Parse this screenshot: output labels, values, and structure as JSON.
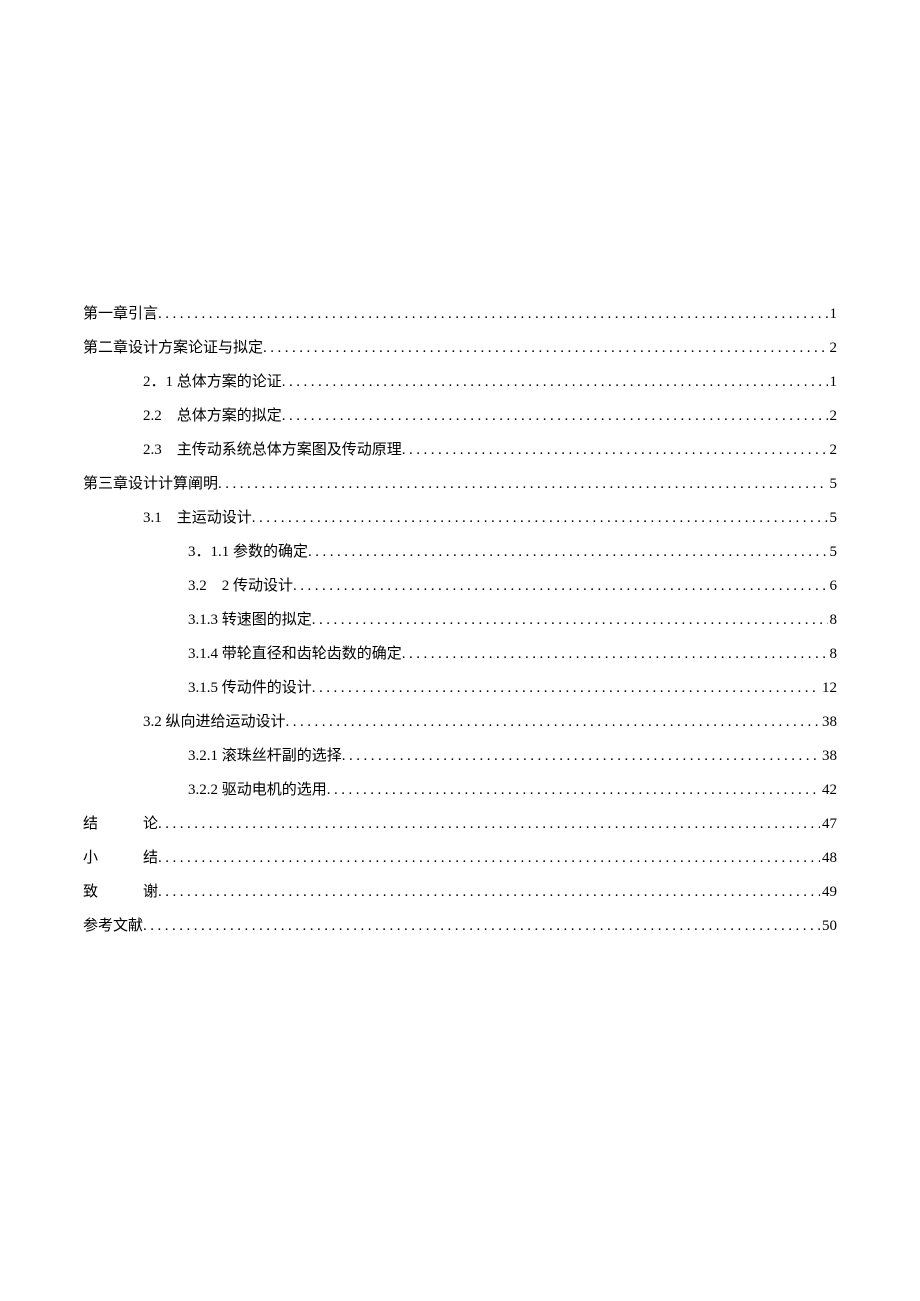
{
  "toc": [
    {
      "indent": 0,
      "label": "第一章引言",
      "page": "1"
    },
    {
      "indent": 0,
      "label": "第二章设计方案论证与拟定",
      "page": "2"
    },
    {
      "indent": 1,
      "label": "2．1 总体方案的论证",
      "page": "1"
    },
    {
      "indent": 1,
      "label": "2.2　总体方案的拟定",
      "page": "2"
    },
    {
      "indent": 1,
      "label": "2.3　主传动系统总体方案图及传动原理",
      "page": "2"
    },
    {
      "indent": 0,
      "label": "第三章设计计算阐明",
      "page": "5"
    },
    {
      "indent": 1,
      "label": "3.1　主运动设计",
      "page": "5"
    },
    {
      "indent": 2,
      "label": "3．1.1 参数的确定",
      "page": "5"
    },
    {
      "indent": 2,
      "label": "3.2　2 传动设计",
      "page": "6"
    },
    {
      "indent": 2,
      "label": "3.1.3 转速图的拟定",
      "page": "8"
    },
    {
      "indent": 2,
      "label": "3.1.4 带轮直径和齿轮齿数的确定",
      "page": "8"
    },
    {
      "indent": 2,
      "label": "3.1.5 传动件的设计",
      "page": "12"
    },
    {
      "indent": 1,
      "label": "3.2 纵向进给运动设计",
      "page": "38"
    },
    {
      "indent": 2,
      "label": "3.2.1 滚珠丝杆副的选择",
      "page": "38"
    },
    {
      "indent": 2,
      "label": "3.2.2 驱动电机的选用",
      "page": "42"
    },
    {
      "indent": 0,
      "label_a": "结",
      "label_b": "论",
      "spaced": true,
      "page": "47"
    },
    {
      "indent": 0,
      "label_a": "小",
      "label_b": "结",
      "spaced": true,
      "page": "48"
    },
    {
      "indent": 0,
      "label_a": "致",
      "label_b": "谢",
      "spaced": true,
      "page": "49"
    },
    {
      "indent": 0,
      "label": "参考文献",
      "page": "50"
    }
  ]
}
